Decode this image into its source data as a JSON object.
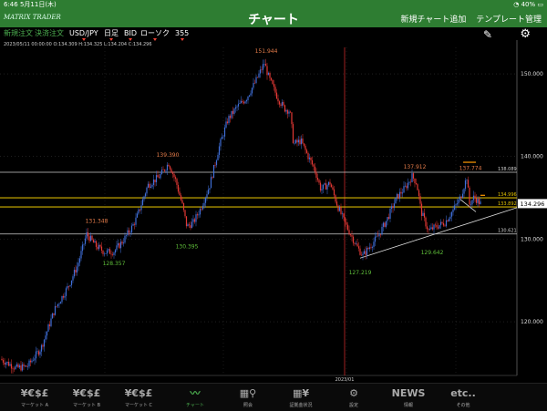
{
  "status": {
    "time": "6:46",
    "date": "5月11日(木)",
    "battery": "40%"
  },
  "header": {
    "logo": "MATRIX TRADER",
    "title": "チャート",
    "add_chart": "新規チャート追加",
    "template": "テンプレート管理"
  },
  "toolbar": {
    "new_order": "新規注文",
    "settle_order": "決済注文",
    "pair": "USD/JPY",
    "period": "日足",
    "side": "BID",
    "style": "ローソク",
    "count": "355"
  },
  "info": {
    "line": "2023/05/11 00:00:00   O:134.309   H:134.325   L:134.204   C:134.296"
  },
  "colors": {
    "brand_green": "#2e7d32",
    "up": "#3f6fd8",
    "down": "#e53935",
    "price_tag": "#ffffff"
  },
  "chart_data": {
    "type": "candlestick",
    "pair": "USD/JPY",
    "y_ticks": [
      "150.000",
      "140.000",
      "130.000",
      "120.000"
    ],
    "ylim": [
      113.5,
      153.2
    ],
    "x_label": "2023/01",
    "current_price": "134.296",
    "labels_max": [
      {
        "text": "151.944",
        "value": 151.944
      },
      {
        "text": "139.390",
        "value": 139.39
      },
      {
        "text": "137.912",
        "value": 137.912
      },
      {
        "text": "131.348",
        "value": 131.348
      },
      {
        "text": "137.774",
        "value": 137.774
      }
    ],
    "labels_min": [
      {
        "text": "130.395",
        "value": 130.395
      },
      {
        "text": "128.357",
        "value": 128.357
      },
      {
        "text": "127.219",
        "value": 127.219
      },
      {
        "text": "129.642",
        "value": 129.642
      }
    ],
    "hlines": [
      {
        "value": 138.089,
        "text": "138.089",
        "color": "#cccccc"
      },
      {
        "value": 134.996,
        "text": "134.996",
        "color": "#d4b300"
      },
      {
        "value": 133.892,
        "text": "133.892",
        "color": "#d4b300"
      },
      {
        "value": 130.621,
        "text": "130.621",
        "color": "#cccccc"
      }
    ],
    "path": [
      [
        0,
        115.5
      ],
      [
        18,
        114.4
      ],
      [
        30,
        114.6
      ],
      [
        45,
        116.8
      ],
      [
        60,
        121.5
      ],
      [
        75,
        124.3
      ],
      [
        85,
        126.8
      ],
      [
        95,
        130.6
      ],
      [
        105,
        129.2
      ],
      [
        115,
        128.4
      ],
      [
        125,
        128.5
      ],
      [
        135,
        129.8
      ],
      [
        145,
        131.5
      ],
      [
        150,
        132.6
      ],
      [
        162,
        136.5
      ],
      [
        175,
        137.6
      ],
      [
        185,
        139.2
      ],
      [
        193,
        137.0
      ],
      [
        200,
        134.1
      ],
      [
        205,
        131.5
      ],
      [
        212,
        132.0
      ],
      [
        220,
        133.7
      ],
      [
        230,
        136.5
      ],
      [
        240,
        141.0
      ],
      [
        250,
        144.5
      ],
      [
        260,
        146.0
      ],
      [
        270,
        147.0
      ],
      [
        280,
        149.0
      ],
      [
        290,
        151.3
      ],
      [
        295,
        149.5
      ],
      [
        305,
        147.0
      ],
      [
        312,
        145.8
      ],
      [
        318,
        145.5
      ],
      [
        322,
        141.5
      ],
      [
        330,
        141.9
      ],
      [
        338,
        140.0
      ],
      [
        345,
        138.5
      ],
      [
        352,
        136.0
      ],
      [
        362,
        136.8
      ],
      [
        370,
        134.1
      ],
      [
        378,
        132.0
      ],
      [
        385,
        130.5
      ],
      [
        392,
        129.0
      ],
      [
        398,
        128.0
      ],
      [
        405,
        129.0
      ],
      [
        415,
        130.4
      ],
      [
        425,
        132.5
      ],
      [
        435,
        135.0
      ],
      [
        445,
        136.3
      ],
      [
        452,
        137.6
      ],
      [
        457,
        136.8
      ],
      [
        462,
        133.3
      ],
      [
        470,
        131.0
      ],
      [
        478,
        131.5
      ],
      [
        488,
        132.0
      ],
      [
        497,
        133.5
      ],
      [
        505,
        135.0
      ],
      [
        512,
        137.5
      ],
      [
        515,
        134.2
      ],
      [
        520,
        135.1
      ],
      [
        525,
        134.5
      ],
      [
        527,
        134.3
      ]
    ]
  },
  "tabs": [
    {
      "icon": "¥€$£",
      "label": "マーケット A"
    },
    {
      "icon": "¥€$£",
      "label": "マーケット B"
    },
    {
      "icon": "¥€$£",
      "label": "マーケット C"
    },
    {
      "icon": "〰",
      "label": "チャート"
    },
    {
      "icon": "▦⚲",
      "label": "照会"
    },
    {
      "icon": "▦¥",
      "label": "証拠金状況"
    },
    {
      "icon": "⚙",
      "label": "設定"
    },
    {
      "icon": "NEWS",
      "label": "情報"
    },
    {
      "icon": "etc..",
      "label": "その他"
    }
  ]
}
